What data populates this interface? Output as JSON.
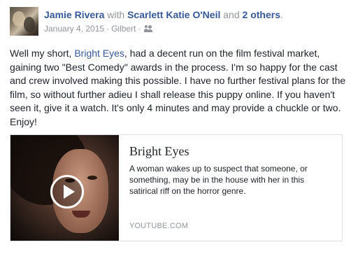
{
  "post": {
    "author": "Jamie Rivera",
    "with_word": "with",
    "tagged": "Scarlett Katie O'Neil",
    "and_word": "and",
    "others": "2 others",
    "end_punct": ".",
    "date": "January 4, 2015",
    "location": "Gilbert",
    "sep": "·",
    "audience_icon": "friends-icon",
    "text_before_link": "Well my short,",
    "text_link": "Bright Eyes",
    "text_after_link": ", had a decent run on the film festival market, gaining two \"Best Comedy\" awards in the process. I'm so happy for the cast and crew involved making this possible. I have no further festival plans for the film, so without further adieu I shall release this puppy online. If you haven't seen it, give it a watch. It's only 4 minutes and may provide a chuckle or two. Enjoy!"
  },
  "attachment": {
    "title": "Bright Eyes",
    "description": "A woman wakes up to suspect that someone, or something, may be in the house with her in this satirical riff on the horror genre.",
    "domain": "YOUTUBE.COM",
    "play_icon": "play-icon"
  },
  "colors": {
    "link": "#365899",
    "meta": "#90949c",
    "text": "#1d2129",
    "border": "#dddfe2"
  }
}
